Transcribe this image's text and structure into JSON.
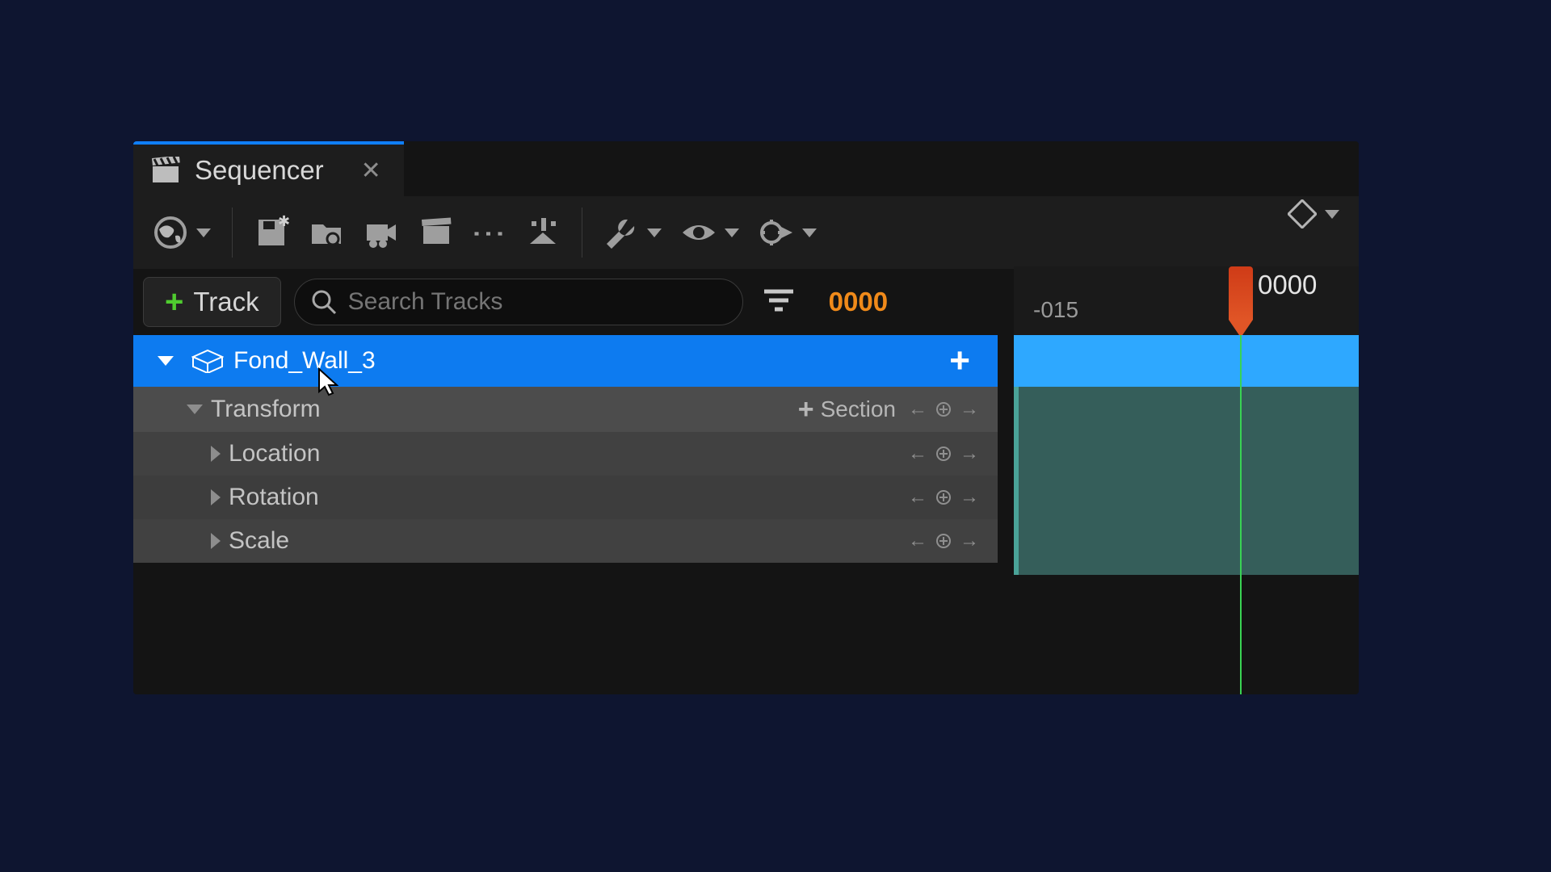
{
  "tab": {
    "title": "Sequencer",
    "close": "✕"
  },
  "track_button": {
    "plus": "+",
    "label": "Track"
  },
  "search": {
    "placeholder": "Search Tracks"
  },
  "frame_left": "0000",
  "timeline": {
    "tick": "-015",
    "frame": "0000"
  },
  "actor": {
    "name": "Fond_Wall_3",
    "add": "+"
  },
  "transform": {
    "label": "Transform",
    "section_btn": {
      "plus": "+",
      "label": "Section"
    },
    "children": {
      "location": "Location",
      "rotation": "Rotation",
      "scale": "Scale"
    }
  }
}
